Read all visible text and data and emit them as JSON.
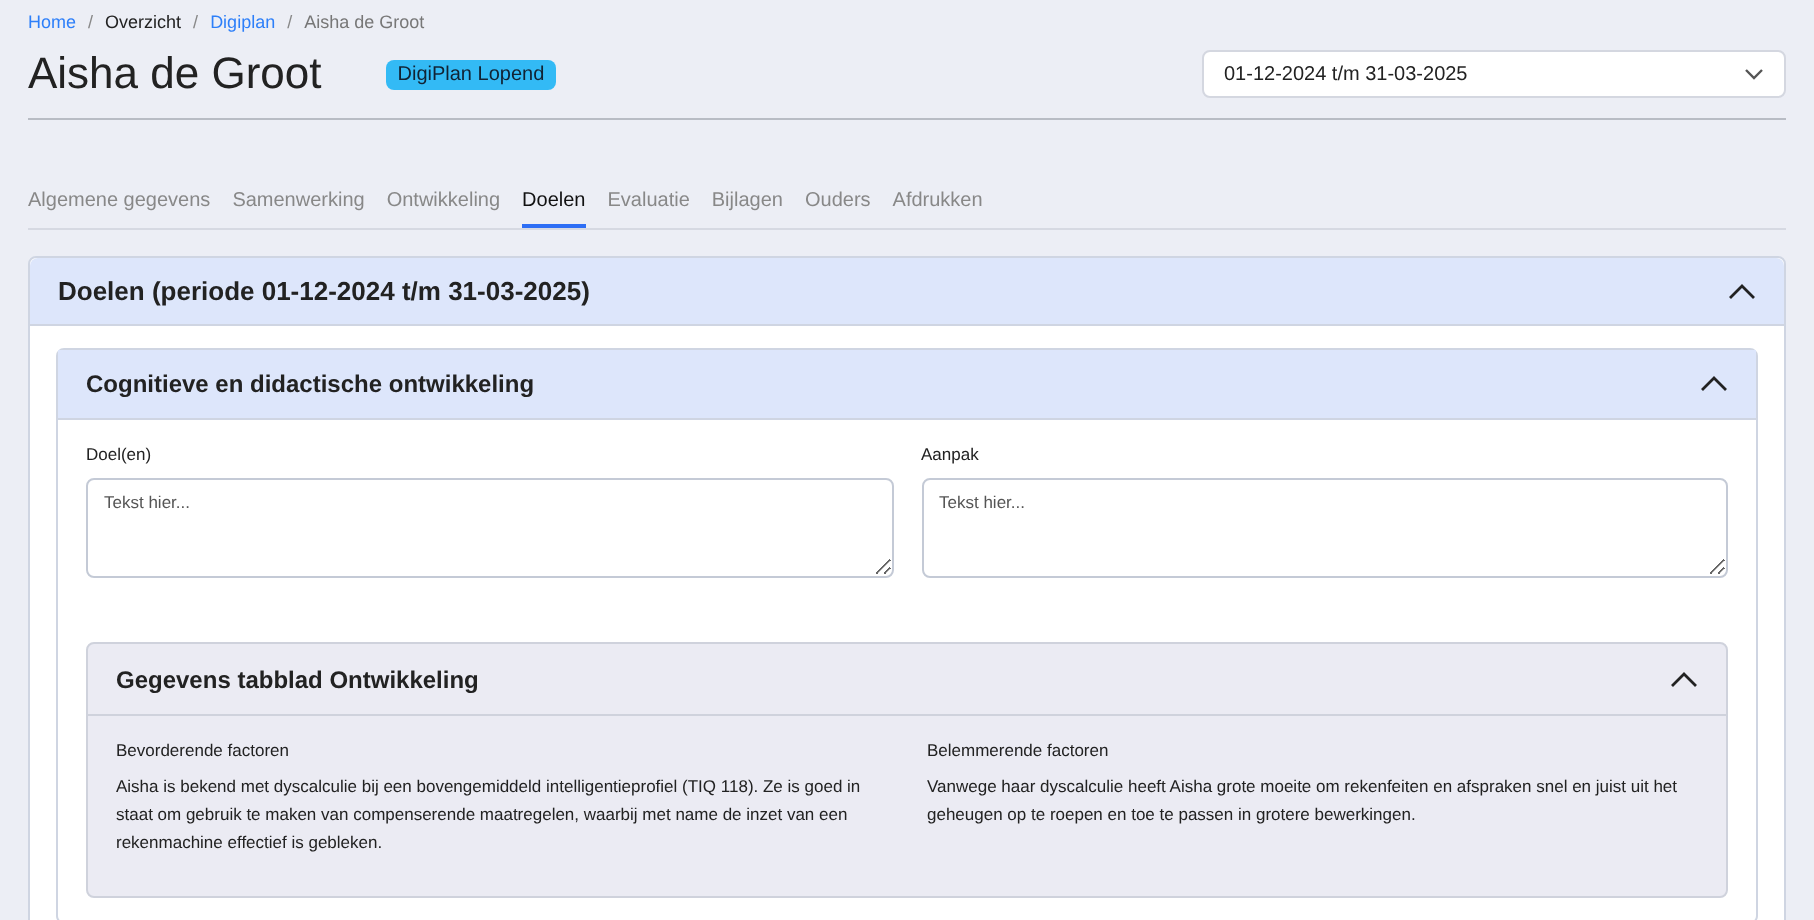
{
  "breadcrumb": [
    {
      "label": "Home",
      "kind": "link"
    },
    {
      "label": "Overzicht",
      "kind": "plain"
    },
    {
      "label": "Digiplan",
      "kind": "link"
    },
    {
      "label": "Aisha de Groot",
      "kind": "current"
    }
  ],
  "breadcrumb_separator": "/",
  "title": "Aisha de Groot",
  "status_badge": "DigiPlan Lopend",
  "period_select": {
    "value": "01-12-2024 t/m 31-03-2025"
  },
  "tabs": [
    {
      "label": "Algemene gegevens",
      "selected": false
    },
    {
      "label": "Samenwerking",
      "selected": false
    },
    {
      "label": "Ontwikkeling",
      "selected": false
    },
    {
      "label": "Doelen",
      "selected": true
    },
    {
      "label": "Evaluatie",
      "selected": false
    },
    {
      "label": "Bijlagen",
      "selected": false
    },
    {
      "label": "Ouders",
      "selected": false
    },
    {
      "label": "Afdrukken",
      "selected": false
    }
  ],
  "panel": {
    "title": "Doelen (periode 01-12-2024 t/m 31-03-2025)",
    "expanded": true,
    "section": {
      "title": "Cognitieve en didactische ontwikkeling",
      "expanded": true,
      "fields": [
        {
          "label": "Doel(en)",
          "placeholder": "Tekst hier..."
        },
        {
          "label": "Aanpak",
          "placeholder": "Tekst hier..."
        }
      ],
      "info": {
        "title": "Gegevens tabblad Ontwikkeling",
        "expanded": true,
        "columns": [
          {
            "label": "Bevorderende factoren",
            "text": "Aisha is bekend met dyscalculie bij een bovengemiddeld intelligentieprofiel (TIQ 118). Ze is goed in staat om gebruik te maken van compenserende maatregelen, waarbij met name de inzet van een rekenmachine effectief is gebleken."
          },
          {
            "label": "Belemmerende factoren",
            "text": "Vanwege haar dyscalculie heeft Aisha grote moeite om rekenfeiten en afspraken snel en juist uit het geheugen op te roepen en toe te passen in grotere bewerkingen."
          }
        ]
      }
    }
  }
}
